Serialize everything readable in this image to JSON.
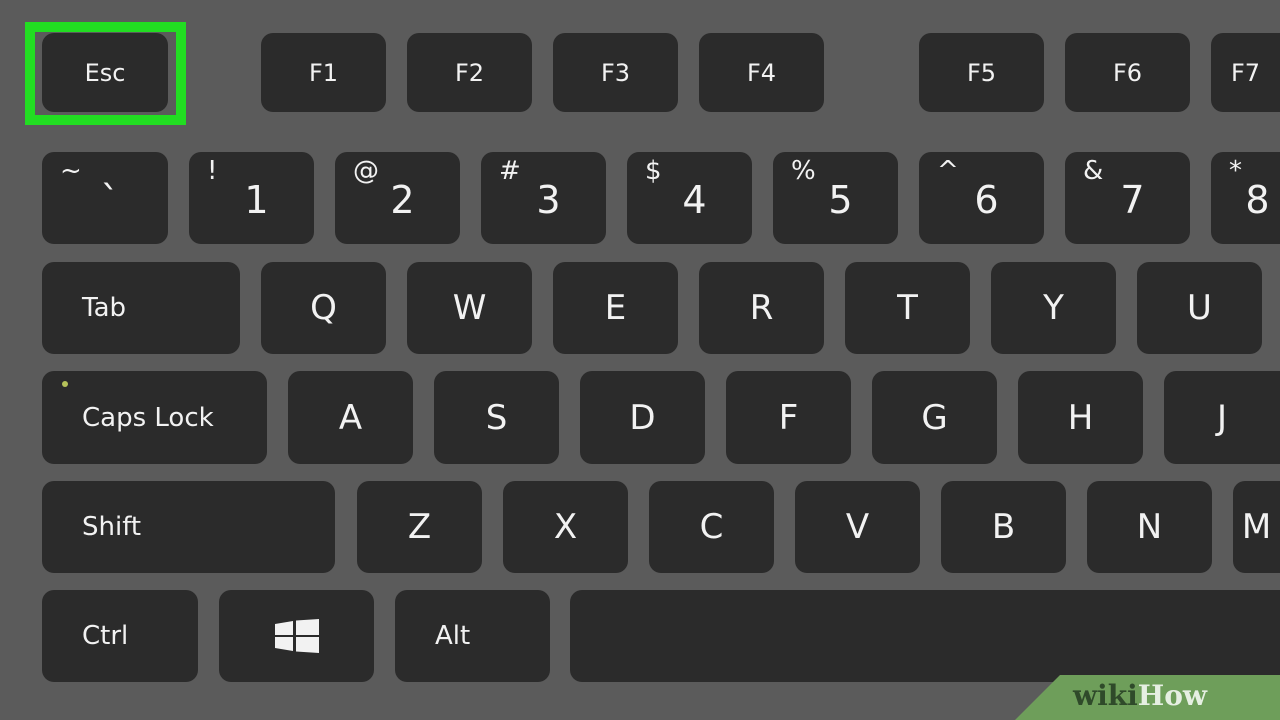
{
  "highlight_color": "#22dd22",
  "highlighted_key": "Esc",
  "rows": [
    [
      {
        "label": "Esc"
      },
      {
        "label": "F1"
      },
      {
        "label": "F2"
      },
      {
        "label": "F3"
      },
      {
        "label": "F4"
      },
      {
        "label": "F5"
      },
      {
        "label": "F6"
      },
      {
        "label": "F7"
      }
    ],
    [
      {
        "label": "`",
        "shift": "~"
      },
      {
        "label": "1",
        "shift": "!"
      },
      {
        "label": "2",
        "shift": "@"
      },
      {
        "label": "3",
        "shift": "#"
      },
      {
        "label": "4",
        "shift": "$"
      },
      {
        "label": "5",
        "shift": "%"
      },
      {
        "label": "6",
        "shift": "^"
      },
      {
        "label": "7",
        "shift": "&"
      },
      {
        "label": "8",
        "shift": "*"
      }
    ],
    [
      {
        "label": "Tab"
      },
      {
        "label": "Q"
      },
      {
        "label": "W"
      },
      {
        "label": "E"
      },
      {
        "label": "R"
      },
      {
        "label": "T"
      },
      {
        "label": "Y"
      },
      {
        "label": "U"
      }
    ],
    [
      {
        "label": "Caps Lock"
      },
      {
        "label": "A"
      },
      {
        "label": "S"
      },
      {
        "label": "D"
      },
      {
        "label": "F"
      },
      {
        "label": "G"
      },
      {
        "label": "H"
      },
      {
        "label": "J"
      }
    ],
    [
      {
        "label": "Shift"
      },
      {
        "label": "Z"
      },
      {
        "label": "X"
      },
      {
        "label": "C"
      },
      {
        "label": "V"
      },
      {
        "label": "B"
      },
      {
        "label": "N"
      },
      {
        "label": "M"
      }
    ],
    [
      {
        "label": "Ctrl"
      },
      {
        "label": "",
        "icon": "windows-logo-icon"
      },
      {
        "label": "Alt"
      },
      {
        "label": ""
      }
    ]
  ],
  "watermark": {
    "part1": "wiki",
    "part2": "How"
  }
}
